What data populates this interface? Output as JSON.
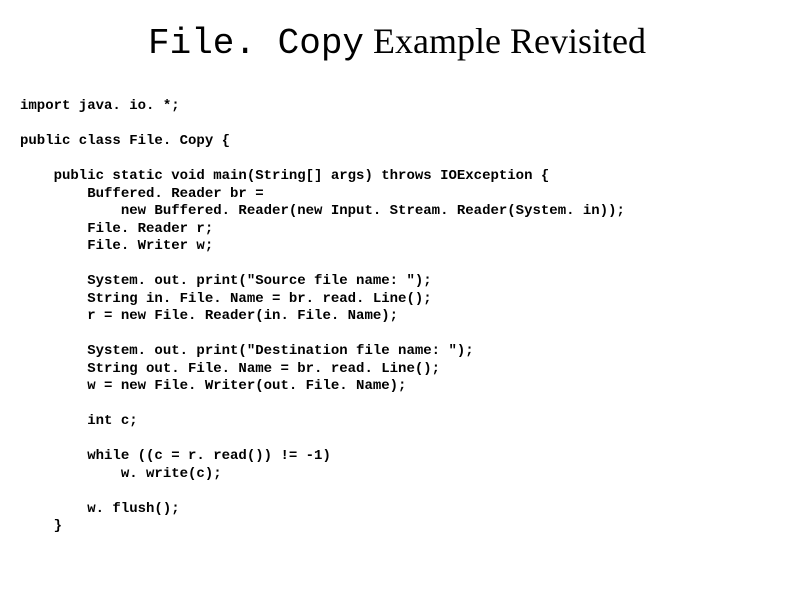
{
  "title": {
    "mono": "File. Copy",
    "rest": " Example Revisited"
  },
  "code": {
    "l01": "import java. io. *;",
    "l02": "",
    "l03": "public class File. Copy {",
    "l04": "",
    "l05": "    public static void main(String[] args) throws IOException {",
    "l06": "        Buffered. Reader br =",
    "l07": "            new Buffered. Reader(new Input. Stream. Reader(System. in));",
    "l08": "        File. Reader r;",
    "l09": "        File. Writer w;",
    "l10": "",
    "l11": "        System. out. print(\"Source file name: \");",
    "l12": "        String in. File. Name = br. read. Line();",
    "l13": "        r = new File. Reader(in. File. Name);",
    "l14": "",
    "l15": "        System. out. print(\"Destination file name: \");",
    "l16": "        String out. File. Name = br. read. Line();",
    "l17": "        w = new File. Writer(out. File. Name);",
    "l18": "",
    "l19": "        int c;",
    "l20": "",
    "l21": "        while ((c = r. read()) != -1)",
    "l22": "            w. write(c);",
    "l23": "",
    "l24": "        w. flush();",
    "l25": "    }"
  }
}
